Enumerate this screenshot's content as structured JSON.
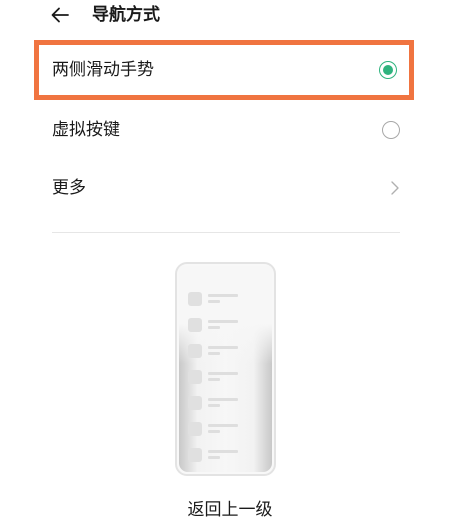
{
  "header": {
    "back_icon": "arrow-left-icon",
    "title": "导航方式"
  },
  "options": [
    {
      "label": "两侧滑动手势",
      "selected": true
    },
    {
      "label": "虚拟按键",
      "selected": false
    }
  ],
  "more": {
    "label": "更多",
    "icon": "chevron-right-icon"
  },
  "illustration": {
    "caption": "返回上一级"
  },
  "colors": {
    "accent": "#2fb37e",
    "highlight_border": "#f07440"
  }
}
